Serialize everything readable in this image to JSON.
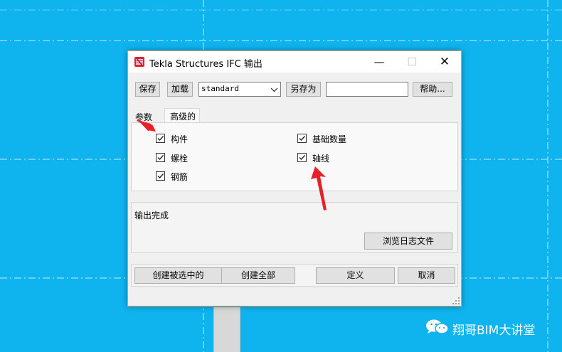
{
  "window": {
    "title": "Tekla Structures IFC 输出",
    "minimize_glyph": "—",
    "maximize_glyph": "☐",
    "close_glyph": "✕"
  },
  "toolbar": {
    "save_label": "保存",
    "load_label": "加载",
    "preset_value": "standard",
    "save_as_label": "另存为",
    "save_as_name": "",
    "help_label": "帮助..."
  },
  "tabs": [
    {
      "label": "参数",
      "active": false
    },
    {
      "label": "高级的",
      "active": true
    }
  ],
  "options": [
    {
      "label": "构件",
      "checked": true
    },
    {
      "label": "螺栓",
      "checked": true
    },
    {
      "label": "钢筋",
      "checked": true
    },
    {
      "label": "基础数量",
      "checked": true
    },
    {
      "label": "轴线",
      "checked": true
    }
  ],
  "status": {
    "message": "输出完成",
    "browse_log_label": "浏览日志文件"
  },
  "actions": {
    "create_selected_label": "创建被选中的",
    "create_all_label": "创建全部",
    "define_label": "定义",
    "cancel_label": "取消"
  },
  "watermark": {
    "text": "翔哥BIM大讲堂"
  },
  "colors": {
    "desktop_bg": "#0fb3ee",
    "annotation_arrow": "#e8202a",
    "dialog_border": "#e0a060"
  },
  "icons": {
    "app": "tekla-logo-icon",
    "checkbox": "checkmark-icon",
    "combo": "chevron-down-icon",
    "watermark": "wechat-icon"
  }
}
